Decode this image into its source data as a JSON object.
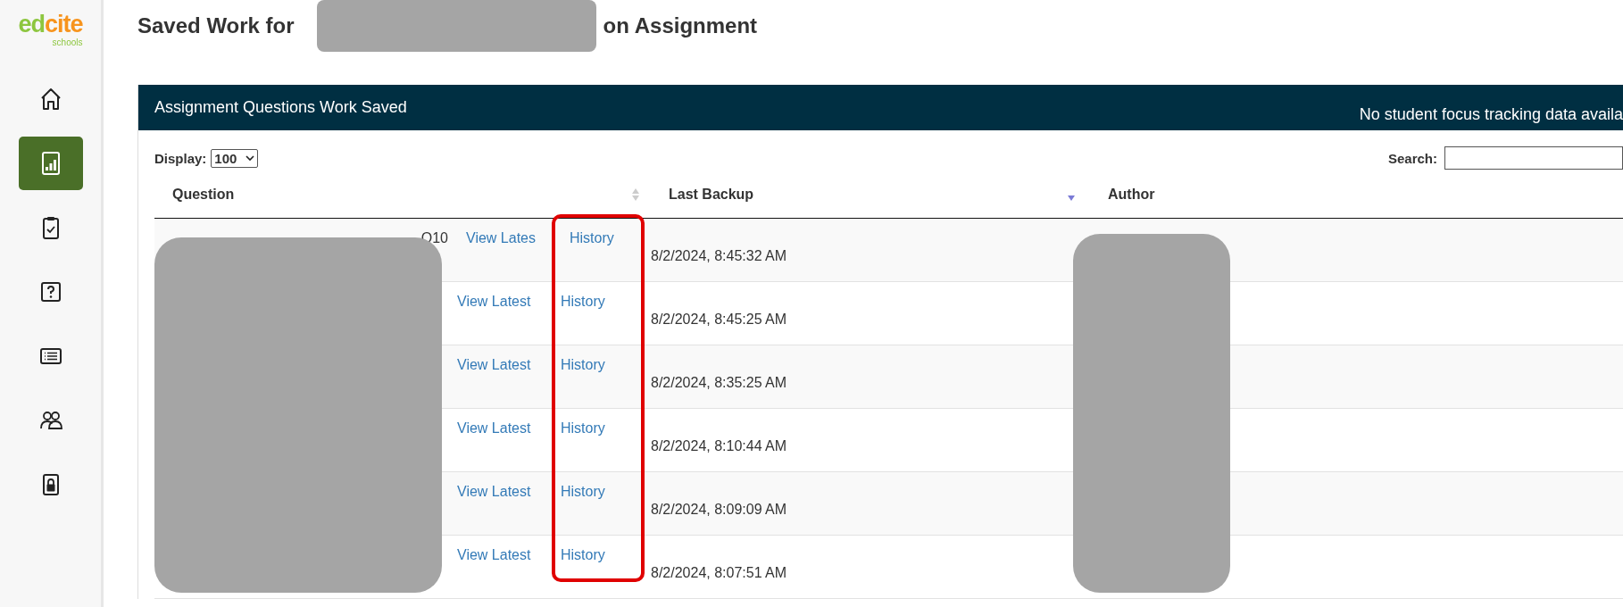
{
  "sidebar": {
    "logo": {
      "word_parts": [
        "ed",
        "cite"
      ],
      "sub": "schools"
    },
    "items": [
      {
        "kind": "home",
        "selected": false
      },
      {
        "kind": "chart",
        "selected": true
      },
      {
        "kind": "clipboard",
        "selected": false
      },
      {
        "kind": "question",
        "selected": false
      },
      {
        "kind": "list",
        "selected": false
      },
      {
        "kind": "people",
        "selected": false
      },
      {
        "kind": "lock",
        "selected": false
      }
    ]
  },
  "title": {
    "before": "Saved Work for",
    "after": "on Assignment"
  },
  "panel": {
    "title": "Assignment Questions Work Saved",
    "notice": "No student focus tracking data availa"
  },
  "display": {
    "label": "Display:",
    "value": "100"
  },
  "search": {
    "label": "Search:"
  },
  "columns": [
    {
      "label": "Question",
      "kind": "sortable"
    },
    {
      "label": "Last Backup",
      "kind": "sorted"
    },
    {
      "label": "Author",
      "kind": "plain"
    }
  ],
  "rows": [
    {
      "question": "Q10",
      "view": "View Lates",
      "history": "History",
      "backup": "8/2/2024, 8:45:32 AM"
    },
    {
      "view": "View Latest",
      "history": "History",
      "backup": "8/2/2024, 8:45:25 AM"
    },
    {
      "view": "View Latest",
      "history": "History",
      "backup": "8/2/2024, 8:35:25 AM"
    },
    {
      "view": "View Latest",
      "history": "History",
      "backup": "8/2/2024, 8:10:44 AM"
    },
    {
      "view": "View Latest",
      "history": "History",
      "backup": "8/2/2024, 8:09:09 AM"
    },
    {
      "view": "View Latest",
      "history": "History",
      "backup": "8/2/2024, 8:07:51 AM"
    }
  ]
}
